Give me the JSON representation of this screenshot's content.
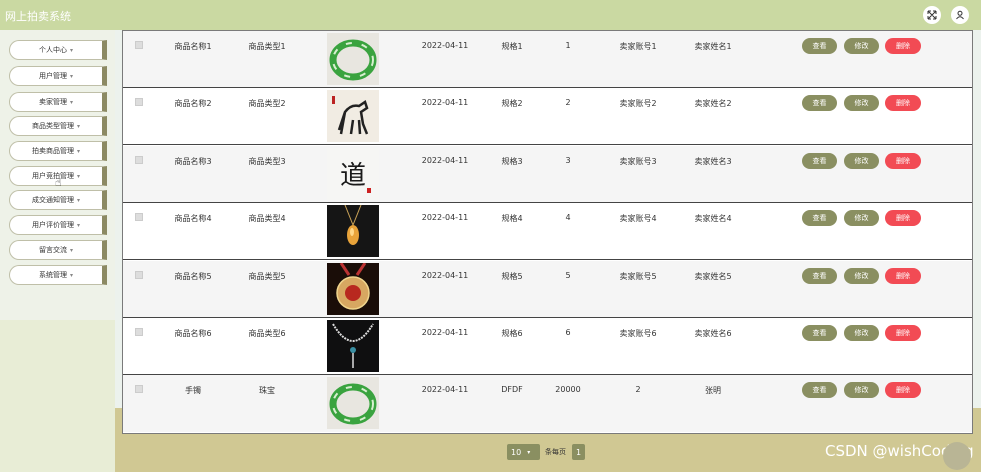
{
  "app": {
    "title": "网上拍卖系统"
  },
  "header_icons": [
    "fullscreen-icon",
    "user-icon"
  ],
  "sidebar": {
    "items": [
      {
        "label": "个人中心"
      },
      {
        "label": "用户管理"
      },
      {
        "label": "卖家管理"
      },
      {
        "label": "商品类型管理"
      },
      {
        "label": "拍卖商品管理"
      },
      {
        "label": "用户竞拍管理"
      },
      {
        "label": "成交通知管理"
      },
      {
        "label": "用户评价管理"
      },
      {
        "label": "留言交流"
      },
      {
        "label": "系统管理"
      }
    ]
  },
  "table": {
    "rows": [
      {
        "name": "商品名称1",
        "type": "商品类型1",
        "image": "green-jade-bangle",
        "date": "2022-04-11",
        "spec": "规格1",
        "qty": "1",
        "seller_account": "卖家账号1",
        "seller_name": "卖家姓名1"
      },
      {
        "name": "商品名称2",
        "type": "商品类型2",
        "image": "horse-painting",
        "date": "2022-04-11",
        "spec": "规格2",
        "qty": "2",
        "seller_account": "卖家账号2",
        "seller_name": "卖家姓名2"
      },
      {
        "name": "商品名称3",
        "type": "商品类型3",
        "image": "calligraphy-dao",
        "date": "2022-04-11",
        "spec": "规格3",
        "qty": "3",
        "seller_account": "卖家账号3",
        "seller_name": "卖家姓名3"
      },
      {
        "name": "商品名称4",
        "type": "商品类型4",
        "image": "amber-pendant",
        "date": "2022-04-11",
        "spec": "规格4",
        "qty": "4",
        "seller_account": "卖家账号4",
        "seller_name": "卖家姓名4"
      },
      {
        "name": "商品名称5",
        "type": "商品类型5",
        "image": "red-medallion",
        "date": "2022-04-11",
        "spec": "规格5",
        "qty": "5",
        "seller_account": "卖家账号5",
        "seller_name": "卖家姓名5"
      },
      {
        "name": "商品名称6",
        "type": "商品类型6",
        "image": "silver-necklace",
        "date": "2022-04-11",
        "spec": "规格6",
        "qty": "6",
        "seller_account": "卖家账号6",
        "seller_name": "卖家姓名6"
      },
      {
        "name": "手镯",
        "type": "珠宝",
        "image": "green-jade-bangle",
        "date": "2022-04-11",
        "spec": "DFDF",
        "qty": "20000",
        "seller_account": "2",
        "seller_name": "张明"
      }
    ],
    "actions": {
      "view": "查看",
      "edit": "修改",
      "delete": "删除"
    }
  },
  "pagination": {
    "page_size": "10",
    "per_page_label": "条每页",
    "current_page": "1"
  },
  "watermark": "CSDN @wishCoding",
  "colors": {
    "topbar": "#cad9a2",
    "accent": "#8a8f61",
    "danger": "#f24b54",
    "menu_border": "#8c8a63"
  }
}
